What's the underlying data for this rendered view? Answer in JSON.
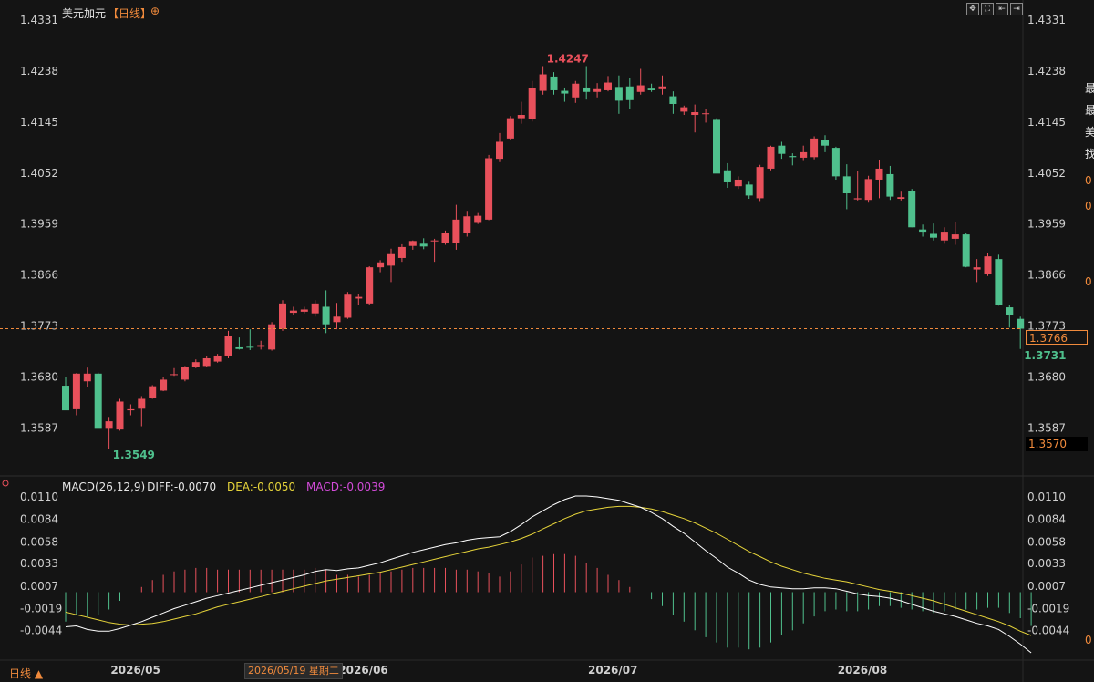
{
  "header": {
    "symbol_name": "美元加元",
    "period": "【日线】",
    "add_symbol_glyph": "⊕",
    "toolbar_icons": [
      "move-icon",
      "fullscreen-icon",
      "back-icon",
      "forward-icon"
    ],
    "toolbar_glyphs": [
      "✥",
      "⛶",
      "⇤",
      "⇥"
    ]
  },
  "price_axis": {
    "ticks": [
      "1.4331",
      "1.4238",
      "1.4145",
      "1.4052",
      "1.3959",
      "1.3866",
      "1.3773",
      "1.3680",
      "1.3587"
    ],
    "last_price_label": "1.3766",
    "lower_tag_label": "1.3570"
  },
  "annotations": {
    "high_label": "1.4247",
    "low_label": "1.3549",
    "recent_low_label": "1.3731"
  },
  "macd": {
    "legend_params": "MACD(26,12,9)",
    "legend_diff": "DIFF:-0.0070",
    "legend_dea": "DEA:-0.0050",
    "legend_macd": "MACD:-0.0039",
    "ticks": [
      "0.0110",
      "0.0084",
      "0.0058",
      "0.0033",
      "0.0007",
      "-0.0019",
      "-0.0044"
    ]
  },
  "time_axis": {
    "labels": [
      "2026/05",
      "2026/06",
      "2026/07",
      "2026/08"
    ],
    "cursor_date": "2026/05/19 星期二"
  },
  "footer": {
    "period_tab": "日线 ▲"
  },
  "right_edge_chars": [
    "最",
    "最",
    "美",
    "找",
    "0",
    "0",
    "0",
    "0"
  ],
  "colors": {
    "up": "#e8505b",
    "down": "#4fc08d",
    "background": "#141414",
    "accent_orange": "#f08a3c",
    "diff_line": "#ffffff",
    "dea_line": "#e6d43a",
    "macd_label": "#d24bd8"
  },
  "chart_data": [
    {
      "type": "candlestick",
      "title": "美元加元【日线】",
      "ylim": [
        1.3541,
        1.4331
      ],
      "x_labels": [
        "2026/05",
        "2026/06",
        "2026/07",
        "2026/08"
      ],
      "candles": [
        {
          "o": 1.3664,
          "h": 1.3679,
          "l": 1.362,
          "c": 1.3619
        },
        {
          "o": 1.3621,
          "h": 1.3687,
          "l": 1.361,
          "c": 1.3686
        },
        {
          "o": 1.3672,
          "h": 1.3697,
          "l": 1.3661,
          "c": 1.3686
        },
        {
          "o": 1.3686,
          "h": 1.3688,
          "l": 1.3606,
          "c": 1.3587
        },
        {
          "o": 1.3587,
          "h": 1.3607,
          "l": 1.3549,
          "c": 1.3599
        },
        {
          "o": 1.3584,
          "h": 1.364,
          "l": 1.3582,
          "c": 1.3635
        },
        {
          "o": 1.3619,
          "h": 1.363,
          "l": 1.361,
          "c": 1.3621
        },
        {
          "o": 1.3622,
          "h": 1.3645,
          "l": 1.359,
          "c": 1.364
        },
        {
          "o": 1.3641,
          "h": 1.3665,
          "l": 1.364,
          "c": 1.3663
        },
        {
          "o": 1.3655,
          "h": 1.368,
          "l": 1.3654,
          "c": 1.3675
        },
        {
          "o": 1.3684,
          "h": 1.3696,
          "l": 1.3682,
          "c": 1.3685
        },
        {
          "o": 1.3675,
          "h": 1.37,
          "l": 1.3672,
          "c": 1.3699
        },
        {
          "o": 1.3699,
          "h": 1.3712,
          "l": 1.3696,
          "c": 1.3707
        },
        {
          "o": 1.37,
          "h": 1.3718,
          "l": 1.3698,
          "c": 1.3714
        },
        {
          "o": 1.3708,
          "h": 1.3722,
          "l": 1.3706,
          "c": 1.3719
        },
        {
          "o": 1.3719,
          "h": 1.3764,
          "l": 1.3714,
          "c": 1.3755
        },
        {
          "o": 1.3734,
          "h": 1.3752,
          "l": 1.373,
          "c": 1.3731
        },
        {
          "o": 1.3735,
          "h": 1.3767,
          "l": 1.3729,
          "c": 1.3734
        },
        {
          "o": 1.3735,
          "h": 1.3746,
          "l": 1.373,
          "c": 1.3738
        },
        {
          "o": 1.373,
          "h": 1.378,
          "l": 1.3728,
          "c": 1.3776
        },
        {
          "o": 1.3768,
          "h": 1.382,
          "l": 1.3764,
          "c": 1.3814
        },
        {
          "o": 1.3797,
          "h": 1.3808,
          "l": 1.3793,
          "c": 1.3801
        },
        {
          "o": 1.3799,
          "h": 1.3808,
          "l": 1.3796,
          "c": 1.3803
        },
        {
          "o": 1.3796,
          "h": 1.382,
          "l": 1.379,
          "c": 1.3814
        },
        {
          "o": 1.3808,
          "h": 1.3838,
          "l": 1.376,
          "c": 1.3776
        },
        {
          "o": 1.378,
          "h": 1.3815,
          "l": 1.3767,
          "c": 1.379
        },
        {
          "o": 1.3788,
          "h": 1.3835,
          "l": 1.3786,
          "c": 1.383
        },
        {
          "o": 1.3823,
          "h": 1.3832,
          "l": 1.3812,
          "c": 1.3826
        },
        {
          "o": 1.3814,
          "h": 1.3882,
          "l": 1.3812,
          "c": 1.388
        },
        {
          "o": 1.388,
          "h": 1.3893,
          "l": 1.3871,
          "c": 1.3889
        },
        {
          "o": 1.3883,
          "h": 1.3914,
          "l": 1.3853,
          "c": 1.3904
        },
        {
          "o": 1.3897,
          "h": 1.3922,
          "l": 1.389,
          "c": 1.3917
        },
        {
          "o": 1.3919,
          "h": 1.3929,
          "l": 1.3912,
          "c": 1.3928
        },
        {
          "o": 1.3923,
          "h": 1.3933,
          "l": 1.3913,
          "c": 1.3918
        },
        {
          "o": 1.3928,
          "h": 1.3932,
          "l": 1.389,
          "c": 1.3929
        },
        {
          "o": 1.3925,
          "h": 1.3947,
          "l": 1.3921,
          "c": 1.3942
        },
        {
          "o": 1.3925,
          "h": 1.3994,
          "l": 1.3912,
          "c": 1.3967
        },
        {
          "o": 1.3942,
          "h": 1.3983,
          "l": 1.3936,
          "c": 1.3973
        },
        {
          "o": 1.3961,
          "h": 1.3979,
          "l": 1.3959,
          "c": 1.3974
        },
        {
          "o": 1.3967,
          "h": 1.4085,
          "l": 1.3966,
          "c": 1.4079
        },
        {
          "o": 1.4078,
          "h": 1.4125,
          "l": 1.4072,
          "c": 1.4109
        },
        {
          "o": 1.4115,
          "h": 1.4156,
          "l": 1.4113,
          "c": 1.4152
        },
        {
          "o": 1.4152,
          "h": 1.4182,
          "l": 1.4142,
          "c": 1.4158
        },
        {
          "o": 1.415,
          "h": 1.422,
          "l": 1.4146,
          "c": 1.4207
        },
        {
          "o": 1.4202,
          "h": 1.4247,
          "l": 1.4195,
          "c": 1.4232
        },
        {
          "o": 1.4228,
          "h": 1.4236,
          "l": 1.4195,
          "c": 1.4203
        },
        {
          "o": 1.4202,
          "h": 1.4208,
          "l": 1.4182,
          "c": 1.4197
        },
        {
          "o": 1.419,
          "h": 1.422,
          "l": 1.418,
          "c": 1.4215
        },
        {
          "o": 1.4208,
          "h": 1.4247,
          "l": 1.4186,
          "c": 1.42
        },
        {
          "o": 1.42,
          "h": 1.4216,
          "l": 1.419,
          "c": 1.4205
        },
        {
          "o": 1.4203,
          "h": 1.4229,
          "l": 1.4201,
          "c": 1.4217
        },
        {
          "o": 1.4209,
          "h": 1.423,
          "l": 1.416,
          "c": 1.4184
        },
        {
          "o": 1.421,
          "h": 1.4225,
          "l": 1.4168,
          "c": 1.4185
        },
        {
          "o": 1.42,
          "h": 1.4242,
          "l": 1.4195,
          "c": 1.4212
        },
        {
          "o": 1.4206,
          "h": 1.4215,
          "l": 1.42,
          "c": 1.4203
        },
        {
          "o": 1.4205,
          "h": 1.423,
          "l": 1.4195,
          "c": 1.421
        },
        {
          "o": 1.4192,
          "h": 1.4201,
          "l": 1.416,
          "c": 1.4178
        },
        {
          "o": 1.4164,
          "h": 1.4175,
          "l": 1.4158,
          "c": 1.4172
        },
        {
          "o": 1.4158,
          "h": 1.4177,
          "l": 1.4126,
          "c": 1.4163
        },
        {
          "o": 1.416,
          "h": 1.4168,
          "l": 1.4144,
          "c": 1.4161
        },
        {
          "o": 1.4149,
          "h": 1.4152,
          "l": 1.4052,
          "c": 1.4051
        },
        {
          "o": 1.4057,
          "h": 1.407,
          "l": 1.4025,
          "c": 1.4035
        },
        {
          "o": 1.4028,
          "h": 1.4046,
          "l": 1.4023,
          "c": 1.404
        },
        {
          "o": 1.4031,
          "h": 1.4036,
          "l": 1.4005,
          "c": 1.4011
        },
        {
          "o": 1.4006,
          "h": 1.4067,
          "l": 1.4001,
          "c": 1.4063
        },
        {
          "o": 1.406,
          "h": 1.4102,
          "l": 1.4057,
          "c": 1.41
        },
        {
          "o": 1.4102,
          "h": 1.4109,
          "l": 1.4078,
          "c": 1.4087
        },
        {
          "o": 1.4083,
          "h": 1.4088,
          "l": 1.4066,
          "c": 1.4081
        },
        {
          "o": 1.408,
          "h": 1.4102,
          "l": 1.4074,
          "c": 1.409
        },
        {
          "o": 1.4081,
          "h": 1.4119,
          "l": 1.4077,
          "c": 1.4115
        },
        {
          "o": 1.4112,
          "h": 1.4121,
          "l": 1.409,
          "c": 1.4102
        },
        {
          "o": 1.4098,
          "h": 1.41,
          "l": 1.404,
          "c": 1.4046
        },
        {
          "o": 1.4046,
          "h": 1.4068,
          "l": 1.3986,
          "c": 1.4015
        },
        {
          "o": 1.4004,
          "h": 1.4056,
          "l": 1.4002,
          "c": 1.4006
        },
        {
          "o": 1.4003,
          "h": 1.4047,
          "l": 1.3998,
          "c": 1.4041
        },
        {
          "o": 1.404,
          "h": 1.4076,
          "l": 1.4006,
          "c": 1.406
        },
        {
          "o": 1.405,
          "h": 1.4065,
          "l": 1.4003,
          "c": 1.4009
        },
        {
          "o": 1.4005,
          "h": 1.4018,
          "l": 1.4002,
          "c": 1.4008
        },
        {
          "o": 1.402,
          "h": 1.4023,
          "l": 1.3953,
          "c": 1.3953
        },
        {
          "o": 1.3949,
          "h": 1.3958,
          "l": 1.3936,
          "c": 1.3945
        },
        {
          "o": 1.3941,
          "h": 1.396,
          "l": 1.3929,
          "c": 1.3934
        },
        {
          "o": 1.3929,
          "h": 1.3953,
          "l": 1.3923,
          "c": 1.3945
        },
        {
          "o": 1.3932,
          "h": 1.3962,
          "l": 1.3921,
          "c": 1.394
        },
        {
          "o": 1.394,
          "h": 1.3942,
          "l": 1.388,
          "c": 1.3881
        },
        {
          "o": 1.3876,
          "h": 1.3895,
          "l": 1.3853,
          "c": 1.388
        },
        {
          "o": 1.3867,
          "h": 1.3906,
          "l": 1.3864,
          "c": 1.39
        },
        {
          "o": 1.3895,
          "h": 1.3903,
          "l": 1.381,
          "c": 1.3812
        },
        {
          "o": 1.3807,
          "h": 1.3812,
          "l": 1.377,
          "c": 1.3793
        },
        {
          "o": 1.3786,
          "h": 1.379,
          "l": 1.3731,
          "c": 1.3768
        }
      ]
    },
    {
      "type": "line",
      "title": "MACD(26,12,9)",
      "ylim": [
        -0.007,
        0.011
      ],
      "series": [
        {
          "name": "DIFF",
          "values": [
            -0.004,
            -0.0039,
            -0.0043,
            -0.0045,
            -0.0045,
            -0.0042,
            -0.0038,
            -0.0034,
            -0.0029,
            -0.0024,
            -0.0019,
            -0.0015,
            -0.0011,
            -0.0007,
            -0.0004,
            -0.0001,
            0.0002,
            0.0005,
            0.0008,
            0.0011,
            0.0014,
            0.0017,
            0.002,
            0.0024,
            0.0026,
            0.0025,
            0.0027,
            0.0028,
            0.0031,
            0.0034,
            0.0038,
            0.0042,
            0.0046,
            0.0049,
            0.0052,
            0.0055,
            0.0057,
            0.006,
            0.0062,
            0.0063,
            0.0064,
            0.007,
            0.0078,
            0.0087,
            0.0094,
            0.0101,
            0.0107,
            0.0111,
            0.0111,
            0.011,
            0.0108,
            0.0106,
            0.0102,
            0.0098,
            0.0092,
            0.0085,
            0.0076,
            0.0068,
            0.0058,
            0.0048,
            0.0039,
            0.0029,
            0.0022,
            0.0014,
            0.0009,
            0.0006,
            0.0005,
            0.0004,
            0.0004,
            0.0005,
            0.0005,
            0.0004,
            0.0001,
            -0.0002,
            -0.0004,
            -0.0005,
            -0.0007,
            -0.001,
            -0.0014,
            -0.0018,
            -0.0022,
            -0.0025,
            -0.0028,
            -0.0032,
            -0.0036,
            -0.0039,
            -0.0043,
            -0.0051,
            -0.006,
            -0.007
          ]
        },
        {
          "name": "DEA",
          "values": [
            -0.0023,
            -0.0026,
            -0.0029,
            -0.0032,
            -0.0035,
            -0.0037,
            -0.0038,
            -0.0037,
            -0.0036,
            -0.0034,
            -0.0031,
            -0.0028,
            -0.0025,
            -0.0021,
            -0.0017,
            -0.0014,
            -0.0011,
            -0.0008,
            -0.0005,
            -0.0002,
            0.0001,
            0.0004,
            0.0007,
            0.001,
            0.0013,
            0.0015,
            0.0017,
            0.0019,
            0.0021,
            0.0023,
            0.0026,
            0.0029,
            0.0032,
            0.0035,
            0.0038,
            0.0041,
            0.0044,
            0.0047,
            0.005,
            0.0052,
            0.0055,
            0.0058,
            0.0062,
            0.0067,
            0.0073,
            0.0079,
            0.0085,
            0.009,
            0.0094,
            0.0096,
            0.0098,
            0.0099,
            0.0099,
            0.0098,
            0.0096,
            0.0093,
            0.0089,
            0.0085,
            0.008,
            0.0074,
            0.0068,
            0.0061,
            0.0054,
            0.0047,
            0.0041,
            0.0035,
            0.003,
            0.0026,
            0.0022,
            0.0019,
            0.0016,
            0.0014,
            0.0012,
            0.0009,
            0.0006,
            0.0003,
            0.0001,
            -0.0001,
            -0.0004,
            -0.0007,
            -0.001,
            -0.0014,
            -0.0018,
            -0.0022,
            -0.0026,
            -0.003,
            -0.0034,
            -0.0039,
            -0.0045,
            -0.005
          ]
        },
        {
          "name": "MACD",
          "values": [
            -0.0034,
            -0.0026,
            -0.0028,
            -0.0026,
            -0.002,
            -0.001,
            0.0,
            0.0006,
            0.0014,
            0.002,
            0.0024,
            0.0026,
            0.0028,
            0.0028,
            0.0026,
            0.0026,
            0.0026,
            0.0026,
            0.0026,
            0.0026,
            0.0026,
            0.0026,
            0.0026,
            0.0028,
            0.0026,
            0.002,
            0.002,
            0.0018,
            0.002,
            0.0022,
            0.0024,
            0.0026,
            0.0028,
            0.0028,
            0.0028,
            0.0028,
            0.0026,
            0.0026,
            0.0024,
            0.0022,
            0.0018,
            0.0024,
            0.0032,
            0.004,
            0.0042,
            0.0044,
            0.0044,
            0.0042,
            0.0034,
            0.0028,
            0.002,
            0.0014,
            0.0006,
            0.0,
            -0.0008,
            -0.0016,
            -0.0026,
            -0.0034,
            -0.0044,
            -0.0052,
            -0.0058,
            -0.0064,
            -0.0064,
            -0.0066,
            -0.0064,
            -0.0058,
            -0.005,
            -0.0044,
            -0.0036,
            -0.0028,
            -0.0022,
            -0.002,
            -0.0022,
            -0.0022,
            -0.002,
            -0.0016,
            -0.0016,
            -0.0018,
            -0.002,
            -0.0022,
            -0.0024,
            -0.0022,
            -0.002,
            -0.002,
            -0.002,
            -0.0018,
            -0.0018,
            -0.0024,
            -0.003,
            -0.0039
          ]
        }
      ]
    }
  ]
}
